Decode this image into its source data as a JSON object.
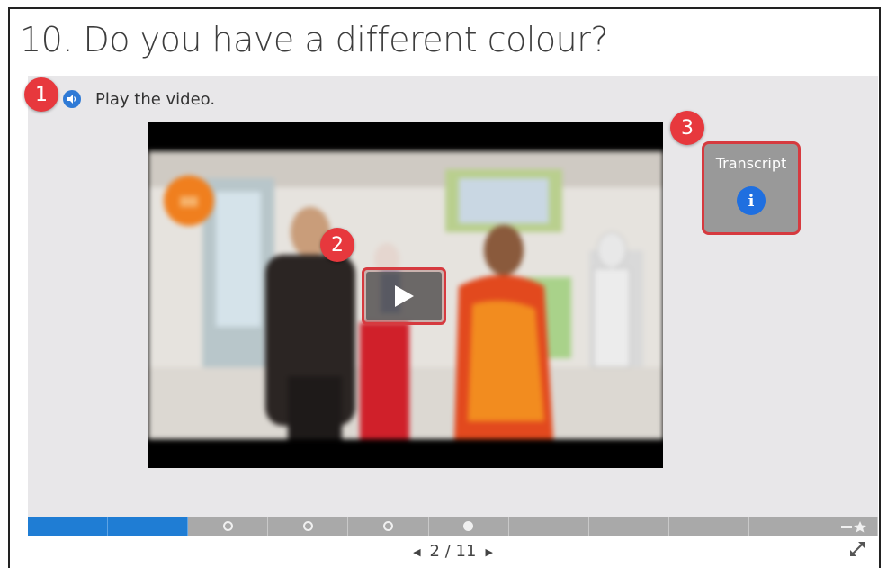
{
  "title": "10. Do you have a different colour?",
  "instruction": {
    "text": "Play the video.",
    "icon": "speaker-icon"
  },
  "callouts": {
    "one": "1",
    "two": "2",
    "three": "3"
  },
  "transcript": {
    "label": "Transcript",
    "icon": "info-icon"
  },
  "pager": {
    "current": "2",
    "separator": "/",
    "total": "11"
  },
  "progress": {
    "segments": [
      "done",
      "done",
      "circle",
      "circle",
      "circle",
      "filled",
      "empty",
      "empty",
      "empty",
      "empty",
      "star"
    ]
  },
  "colors": {
    "accent": "#1f7dd4",
    "callout": "#e7383d",
    "info": "#1f6fe0"
  }
}
